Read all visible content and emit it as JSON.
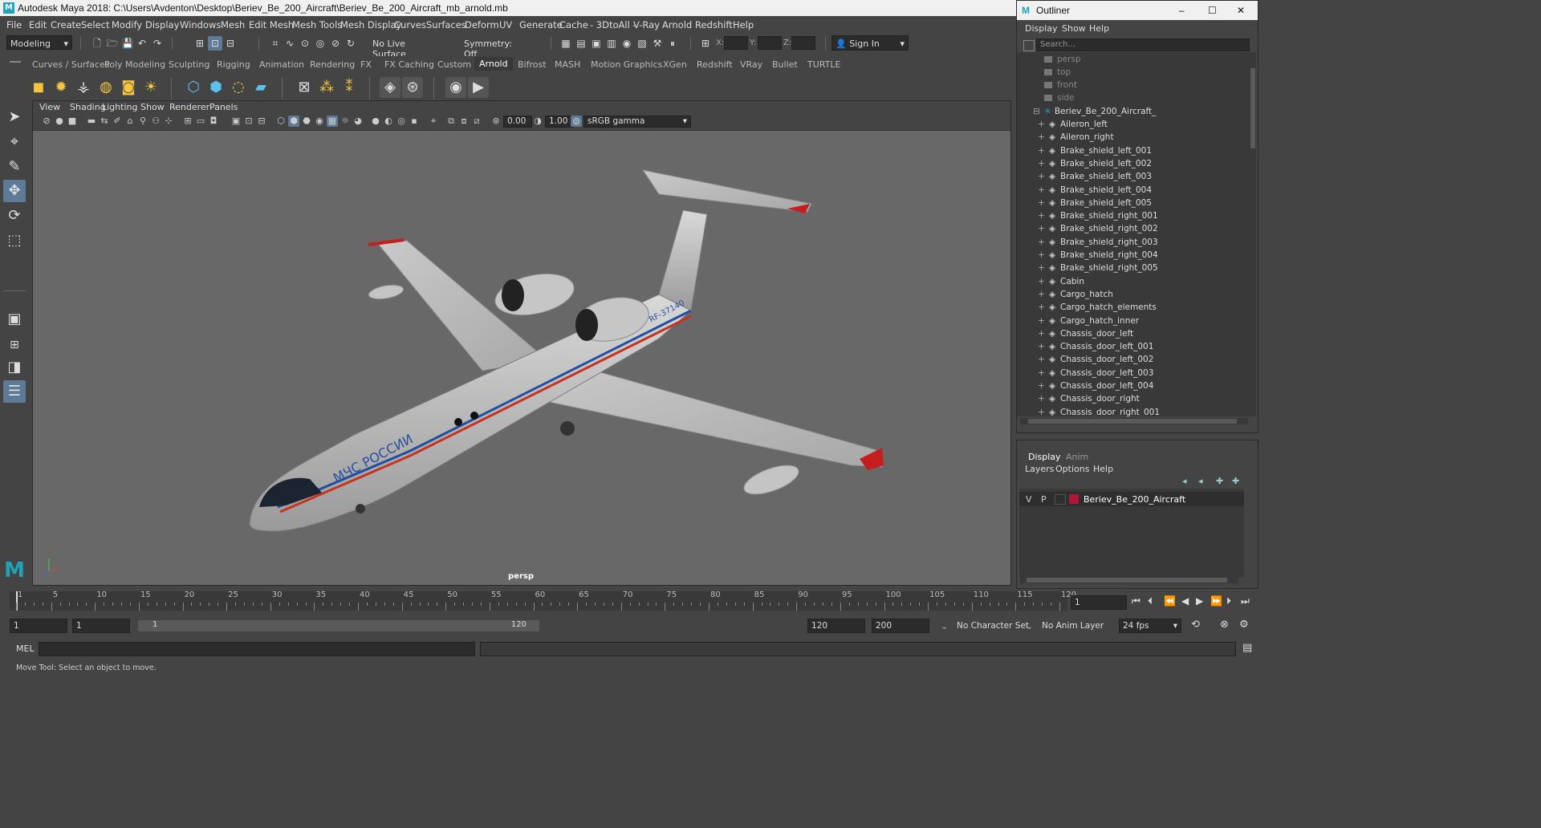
{
  "window": {
    "title": "Autodesk Maya 2018: C:\\Users\\Avdenton\\Desktop\\Beriev_Be_200_Aircraft\\Beriev_Be_200_Aircraft_mb_arnold.mb"
  },
  "menubar": [
    "File",
    "Edit",
    "Create",
    "Select",
    "Modify",
    "Display",
    "Windows",
    "Mesh",
    "Edit Mesh",
    "Mesh Tools",
    "Mesh Display",
    "Curves",
    "Surfaces",
    "Deform",
    "UV",
    "Generate",
    "Cache",
    "- 3DtoAll -",
    "V-Ray",
    "Arnold",
    "Redshift",
    "Help"
  ],
  "statusline": {
    "mode": "Modeling",
    "live_surface": "No Live Surface",
    "symmetry": "Symmetry: Off",
    "x_label": "X:",
    "y_label": "Y:",
    "z_label": "Z:",
    "sign_in": "Sign In"
  },
  "shelf_tabs": [
    "Curves / Surfaces",
    "Poly Modeling",
    "Sculpting",
    "Rigging",
    "Animation",
    "Rendering",
    "FX",
    "FX Caching",
    "Custom",
    "Arnold",
    "Bifrost",
    "MASH",
    "Motion Graphics",
    "XGen",
    "Redshift",
    "VRay",
    "Bullet",
    "TURTLE"
  ],
  "shelf_active": "Arnold",
  "viewport": {
    "menu": [
      "View",
      "Shading",
      "Lighting",
      "Show",
      "Renderer",
      "Panels"
    ],
    "exposure": "0.00",
    "gamma": "1.00",
    "colorspace": "sRGB gamma",
    "camera": "persp",
    "decal_text": "МЧС РОССИИ",
    "tail_text": "RF-37140"
  },
  "outliner": {
    "title": "Outliner",
    "menu": [
      "Display",
      "Show",
      "Help"
    ],
    "search_placeholder": "Search...",
    "cameras": [
      "persp",
      "top",
      "front",
      "side"
    ],
    "group": "Beriev_Be_200_Aircraft_",
    "items": [
      "Aileron_left",
      "Aileron_right",
      "Brake_shield_left_001",
      "Brake_shield_left_002",
      "Brake_shield_left_003",
      "Brake_shield_left_004",
      "Brake_shield_left_005",
      "Brake_shield_right_001",
      "Brake_shield_right_002",
      "Brake_shield_right_003",
      "Brake_shield_right_004",
      "Brake_shield_right_005",
      "Cabin",
      "Cargo_hatch",
      "Cargo_hatch_elements",
      "Cargo_hatch_inner",
      "Chassis_door_left",
      "Chassis_door_left_001",
      "Chassis_door_left_002",
      "Chassis_door_left_003",
      "Chassis_door_left_004",
      "Chassis_door_right",
      "Chassis_door_right_001"
    ]
  },
  "layer_editor": {
    "tabs": [
      "Display",
      "Anim"
    ],
    "menu": [
      "Layers",
      "Options",
      "Help"
    ],
    "layer": {
      "v": "V",
      "p": "P",
      "name": "Beriev_Be_200_Aircraft",
      "color": "#b0163a"
    }
  },
  "timeline": {
    "ticks": [
      "1",
      "5",
      "10",
      "15",
      "20",
      "25",
      "30",
      "35",
      "40",
      "45",
      "50",
      "55",
      "60",
      "65",
      "70",
      "75",
      "80",
      "85",
      "90",
      "95",
      "100",
      "105",
      "110",
      "115",
      "120"
    ],
    "current_frame": "1"
  },
  "range": {
    "start": "1",
    "anim_start": "1",
    "range_start": "1",
    "range_end": "120",
    "end": "120",
    "anim_end": "200",
    "character_set": "No Character Set",
    "anim_layer": "No Anim Layer",
    "fps": "24 fps"
  },
  "cmdline": {
    "label": "MEL"
  },
  "helpline": {
    "text": "Move Tool: Select an object to move."
  },
  "colors": {
    "accent": "#5d7a96",
    "brand": "#1fa3b6"
  }
}
